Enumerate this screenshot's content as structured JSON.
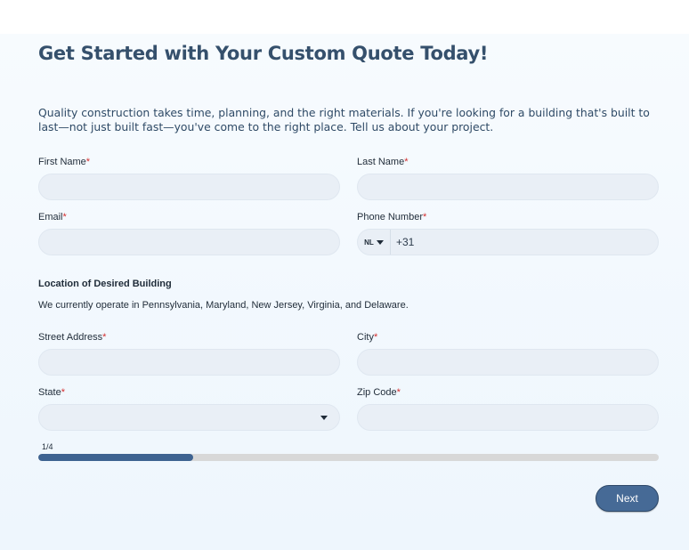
{
  "header": {
    "title": "Get Started with Your Custom Quote Today!",
    "intro": "Quality construction takes time, planning, and the right materials. If you're looking for a building that's built to last—not just built fast—you've come to the right place. Tell us about your project."
  },
  "form": {
    "required_marker": "*",
    "first_name": {
      "label": "First Name",
      "value": ""
    },
    "last_name": {
      "label": "Last Name",
      "value": ""
    },
    "email": {
      "label": "Email",
      "value": ""
    },
    "phone": {
      "label": "Phone Number",
      "country": "NL",
      "value": "+31"
    },
    "location": {
      "heading": "Location of Desired Building",
      "note": "We currently operate in Pennsylvania, Maryland, New Jersey, Virginia, and Delaware."
    },
    "street": {
      "label": "Street Address",
      "value": ""
    },
    "city": {
      "label": "City",
      "value": ""
    },
    "state": {
      "label": "State",
      "value": ""
    },
    "zip": {
      "label": "Zip Code",
      "value": ""
    }
  },
  "progress": {
    "step_text": "1/4",
    "fraction": 0.25
  },
  "actions": {
    "next_label": "Next"
  },
  "colors": {
    "title": "#35506c",
    "accent": "#466a96",
    "progress_fill": "#3e6391",
    "required": "#d32f2f"
  }
}
